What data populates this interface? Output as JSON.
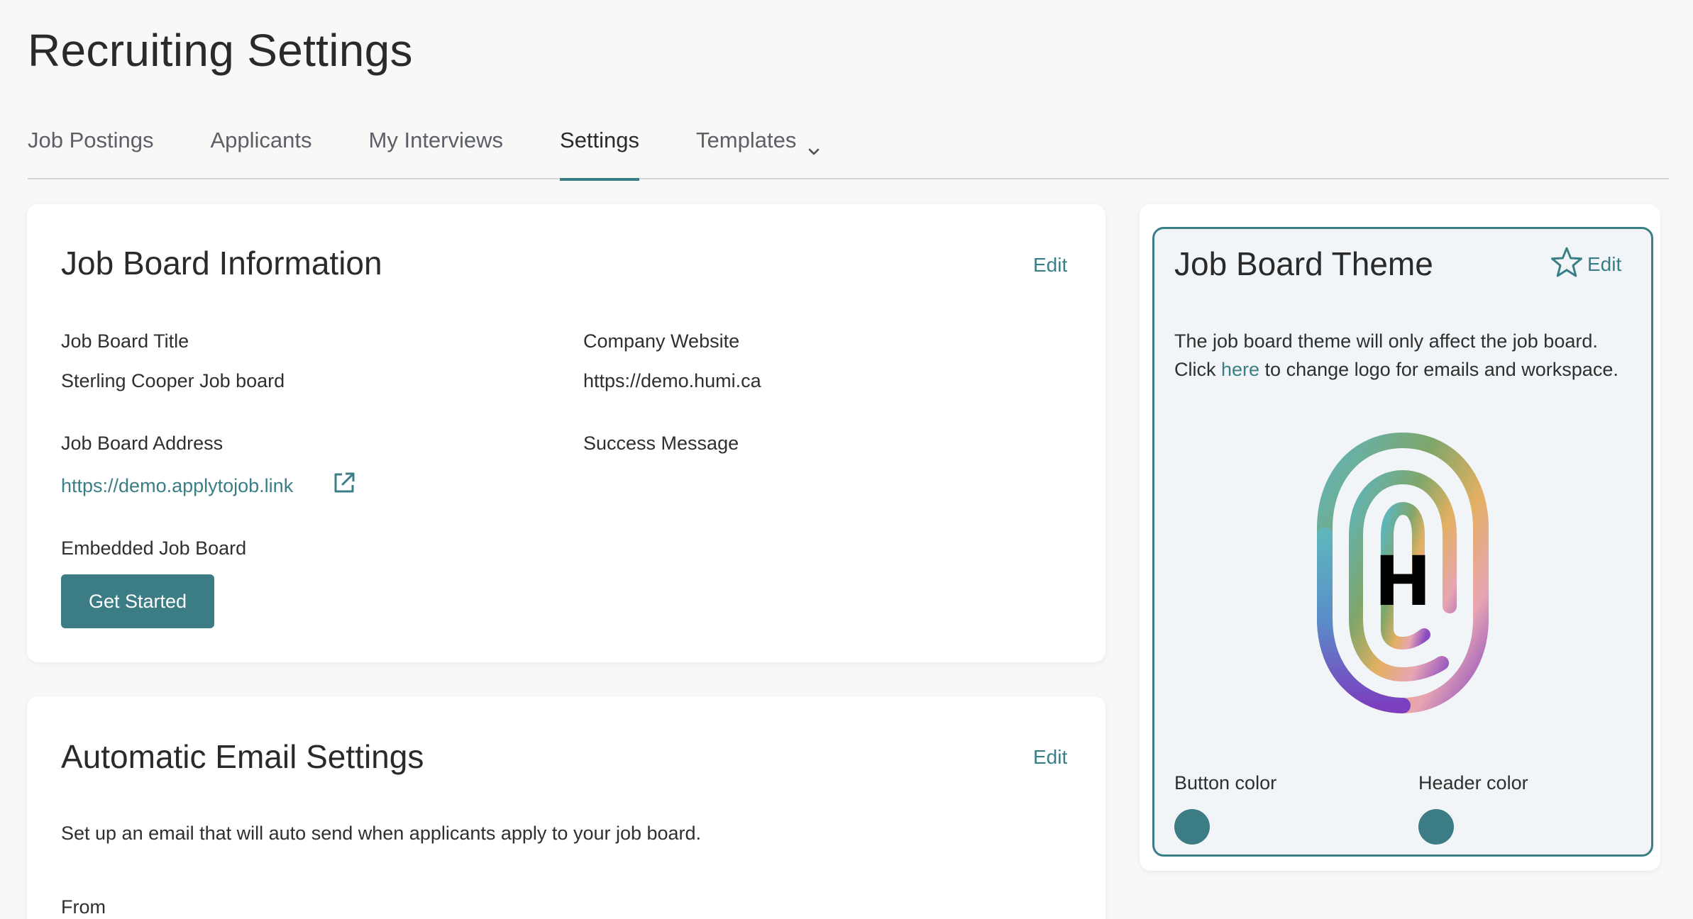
{
  "page": {
    "title": "Recruiting Settings"
  },
  "tabs": [
    {
      "label": "Job Postings"
    },
    {
      "label": "Applicants"
    },
    {
      "label": "My Interviews"
    },
    {
      "label": "Settings"
    },
    {
      "label": "Templates"
    }
  ],
  "job_board_info": {
    "heading": "Job Board Information",
    "edit_label": "Edit",
    "title_label": "Job Board Title",
    "title_value": "Sterling Cooper Job board",
    "website_label": "Company Website",
    "website_value": "https://demo.humi.ca",
    "address_label": "Job Board Address",
    "address_value": "https://demo.applytojob.link",
    "success_label": "Success Message",
    "embedded_label": "Embedded Job Board",
    "get_started_label": "Get Started"
  },
  "email_settings": {
    "heading": "Automatic Email Settings",
    "edit_label": "Edit",
    "description": "Set up an email that will auto send when applicants apply to your job board.",
    "from_label": "From"
  },
  "theme": {
    "heading": "Job Board Theme",
    "edit_label": "Edit",
    "desc_before": "The job board theme will only affect the job board. Click ",
    "desc_link": "here",
    "desc_after": " to change logo for emails and workspace.",
    "logo_letter": "H",
    "button_color_label": "Button color",
    "header_color_label": "Header color",
    "button_color": "#3b7c85",
    "header_color": "#3b7c85"
  },
  "colors": {
    "accent": "#3a7e86"
  }
}
